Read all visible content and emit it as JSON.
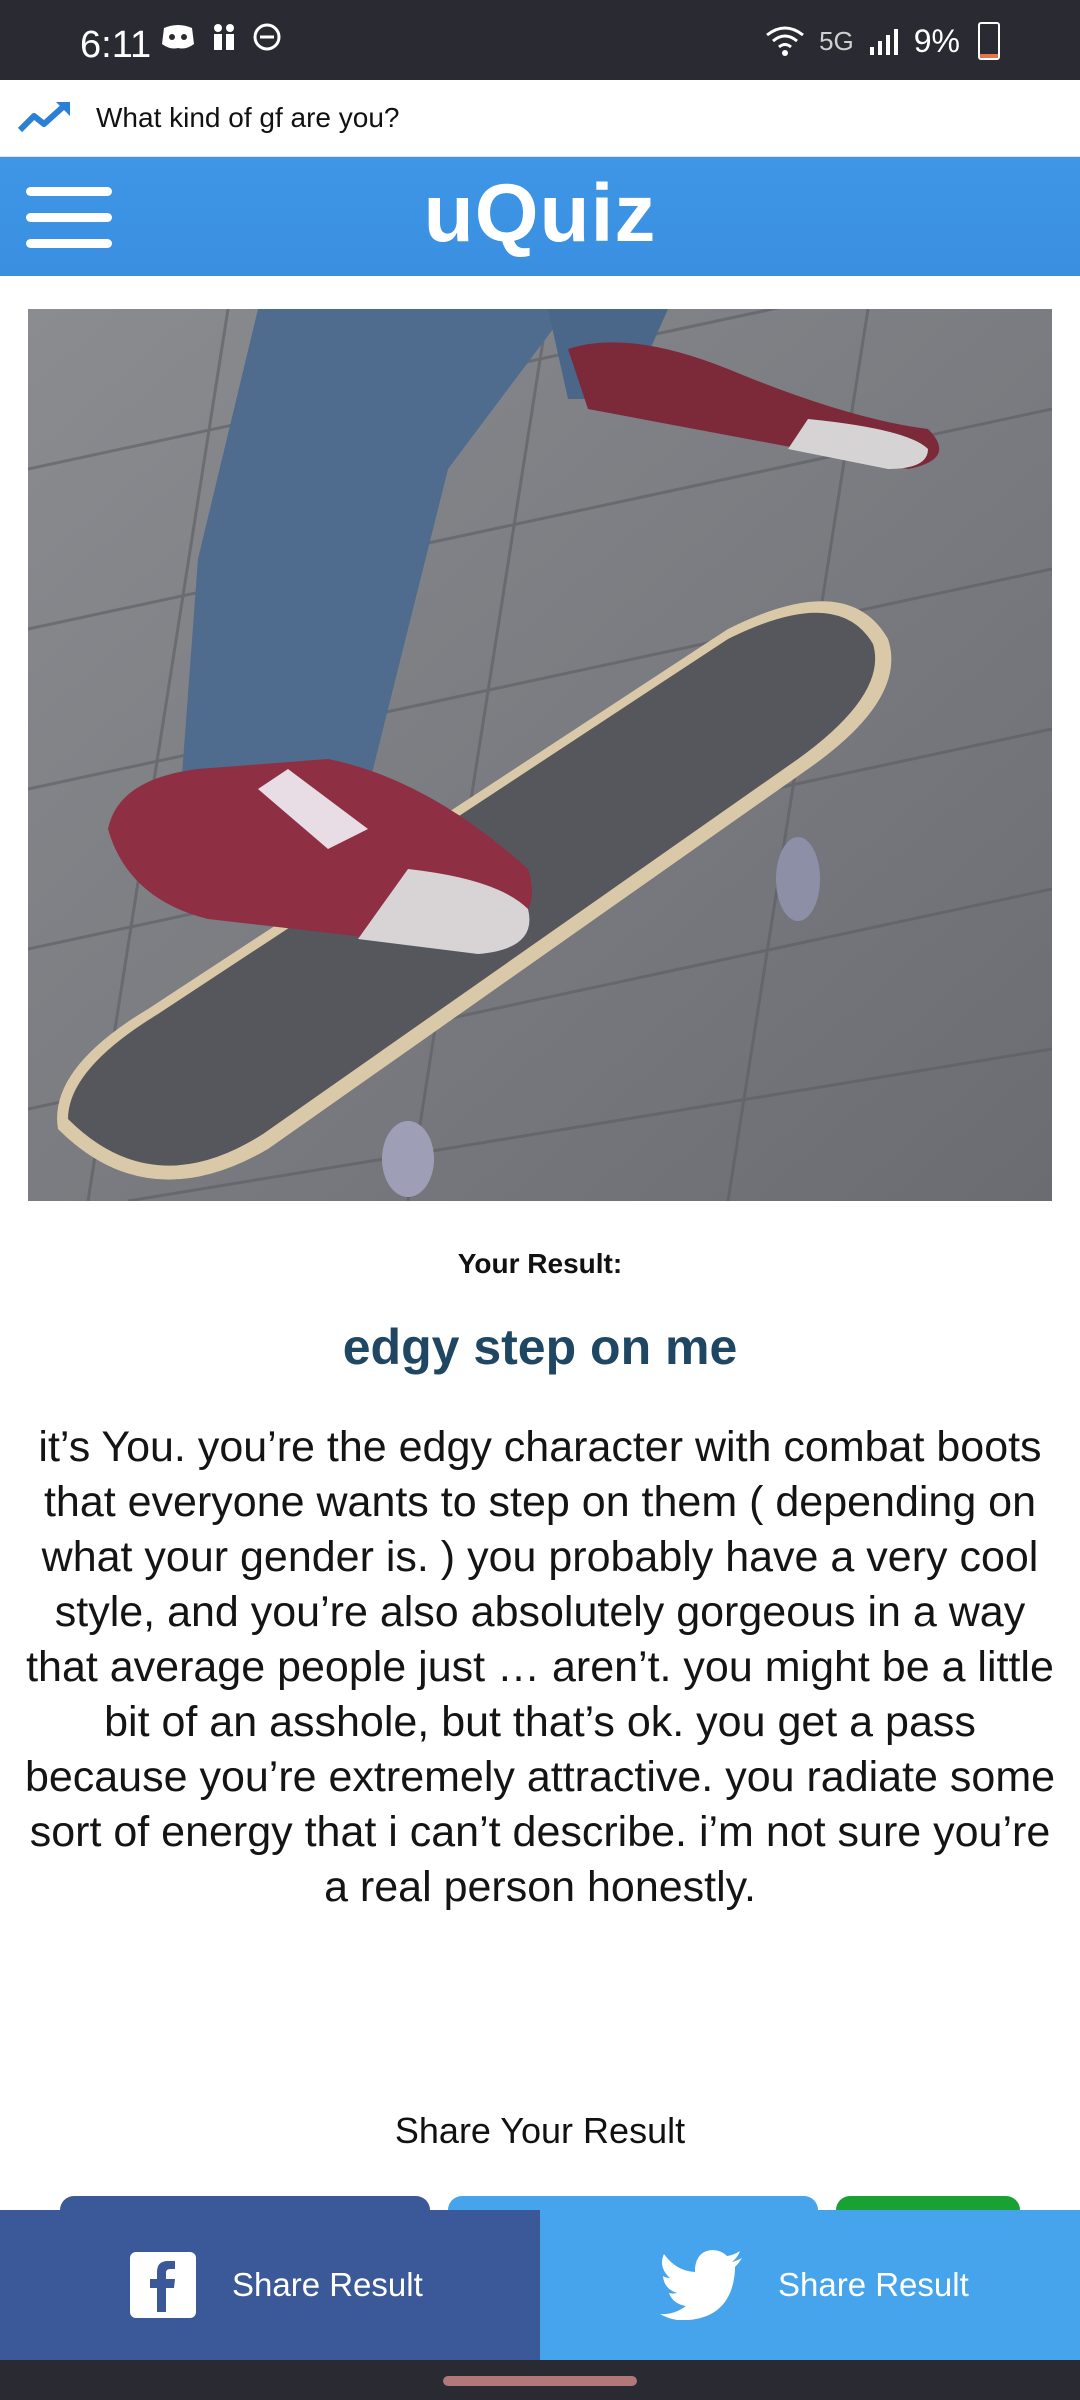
{
  "status": {
    "time": "6:11",
    "network": "5G",
    "battery": "9%",
    "battery_level": 0.09,
    "icons_left": [
      "discord-icon",
      "people-icon",
      "do-not-disturb-icon"
    ],
    "icons_right": [
      "wifi-icon",
      "signal-icon",
      "battery-icon"
    ]
  },
  "topic": {
    "text": "What kind of gf are you?",
    "icon": "trending-icon"
  },
  "header": {
    "logo": "uQuiz",
    "menu_icon": "hamburger-menu-icon",
    "color": "#3d93e3"
  },
  "result": {
    "image_alt": "skateboard",
    "label": "Your Result:",
    "title": "edgy step on me",
    "description": "it’s You. you’re the edgy character with combat boots that everyone wants to step on them ( depending on what your gender is. ) you probably have a very cool style, and you’re also absolutely gorgeous in a way that average people just … aren’t. you might be a little bit of an asshole, but that’s ok. you get a pass because you’re extremely attractive. you radiate some sort of energy that i can’t describe. i’m not sure you’re a real person honestly."
  },
  "share": {
    "heading": "Share Your Result",
    "facebook_label": "Share Result",
    "twitter_label": "Share Result",
    "facebook_color": "#3b5998",
    "twitter_color": "#45a4ec"
  }
}
